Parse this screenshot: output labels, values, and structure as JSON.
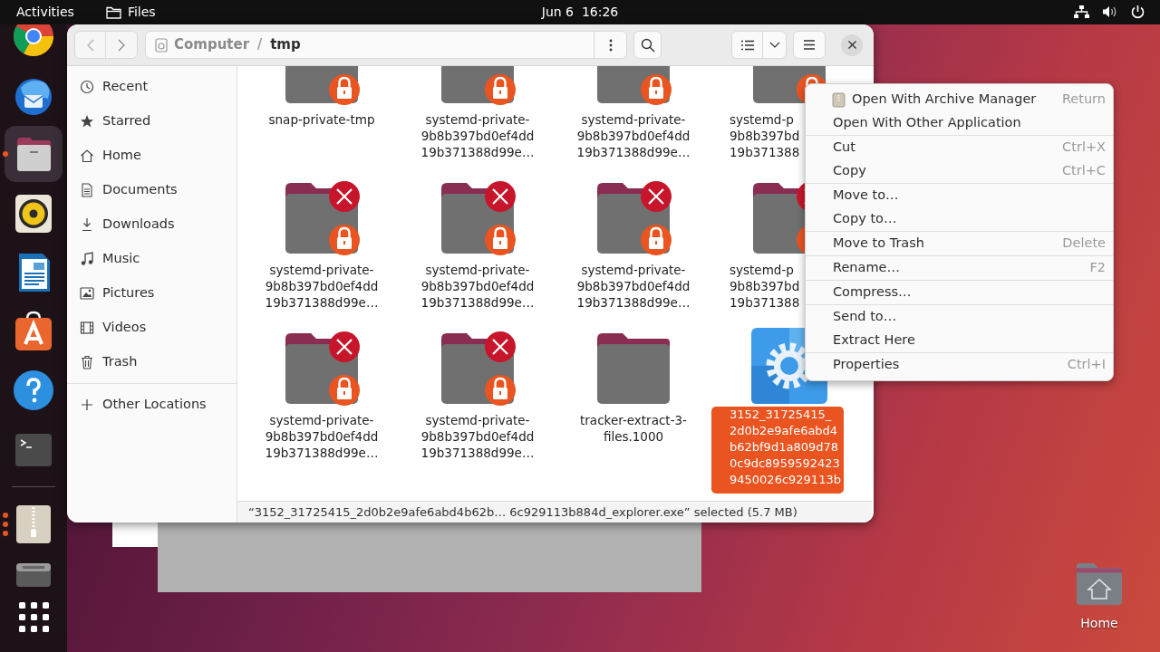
{
  "top_bar": {
    "activities": "Activities",
    "app_name": "Files",
    "clock": "Jun 6  16:26"
  },
  "dock": {
    "favorites": [
      {
        "active": false,
        "running": false
      },
      {
        "active": false,
        "running": false
      },
      {
        "active": true,
        "running": true,
        "multiple_windows": false
      },
      {
        "active": false,
        "running": false
      },
      {
        "active": false,
        "running": false
      },
      {
        "active": false,
        "running": false
      },
      {
        "active": false,
        "running": false
      },
      {
        "active": false,
        "running": false
      }
    ],
    "running": [
      {
        "active": false,
        "running": true,
        "multiple_windows": true
      },
      {
        "active": false,
        "running": false
      }
    ]
  },
  "files_window": {
    "path": [
      {
        "label": "Computer",
        "selected": false
      },
      {
        "label": "tmp",
        "selected": true
      }
    ],
    "path_separator": "/",
    "sidebar": {
      "places": [
        {
          "label": "Recent",
          "selected": false
        },
        {
          "label": "Starred",
          "selected": false
        },
        {
          "label": "Home",
          "selected": false
        },
        {
          "label": "Documents",
          "selected": false
        },
        {
          "label": "Downloads",
          "selected": false
        },
        {
          "label": "Music",
          "selected": false
        },
        {
          "label": "Pictures",
          "selected": false
        },
        {
          "label": "Videos",
          "selected": false
        },
        {
          "label": "Trash",
          "selected": false
        }
      ],
      "other": {
        "label": "Other Locations",
        "selected": false
      }
    },
    "items": [
      {
        "kind": "folder",
        "locked": true,
        "unreadable": false,
        "selected": false,
        "label_lines": [
          "snap-private-tmp"
        ]
      },
      {
        "kind": "folder",
        "locked": true,
        "unreadable": false,
        "selected": false,
        "label_lines": [
          "systemd-private-",
          "9b8b397bd0ef4dd",
          "19b371388d99e…"
        ]
      },
      {
        "kind": "folder",
        "locked": true,
        "unreadable": false,
        "selected": false,
        "label_lines": [
          "systemd-private-",
          "9b8b397bd0ef4dd",
          "19b371388d99e…"
        ]
      },
      {
        "kind": "folder",
        "locked": true,
        "unreadable": false,
        "selected": false,
        "label_lines": [
          "systemd-p",
          "9b8b397bd",
          "19b371388"
        ]
      },
      {
        "kind": "folder",
        "locked": true,
        "unreadable": true,
        "selected": false,
        "label_lines": [
          "systemd-private-",
          "9b8b397bd0ef4dd",
          "19b371388d99e…"
        ]
      },
      {
        "kind": "folder",
        "locked": true,
        "unreadable": true,
        "selected": false,
        "label_lines": [
          "systemd-private-",
          "9b8b397bd0ef4dd",
          "19b371388d99e…"
        ]
      },
      {
        "kind": "folder",
        "locked": true,
        "unreadable": true,
        "selected": false,
        "label_lines": [
          "systemd-private-",
          "9b8b397bd0ef4dd",
          "19b371388d99e…"
        ]
      },
      {
        "kind": "folder",
        "locked": true,
        "unreadable": true,
        "selected": false,
        "label_lines": [
          "systemd-p",
          "9b8b397bd",
          "19b371388"
        ]
      },
      {
        "kind": "folder",
        "locked": true,
        "unreadable": true,
        "selected": false,
        "label_lines": [
          "systemd-private-",
          "9b8b397bd0ef4dd",
          "19b371388d99e…"
        ]
      },
      {
        "kind": "folder",
        "locked": true,
        "unreadable": true,
        "selected": false,
        "label_lines": [
          "systemd-private-",
          "9b8b397bd0ef4dd",
          "19b371388d99e…"
        ]
      },
      {
        "kind": "folder",
        "locked": false,
        "unreadable": false,
        "selected": false,
        "label_lines": [
          "tracker-extract-3-",
          "files.1000"
        ]
      },
      {
        "kind": "executable",
        "selected": true,
        "label_lines": [
          "3152_31725415_",
          "2d0b2e9afe6abd4",
          "b62bf9d1a809d78",
          "0c9dc8959592423",
          "9450026c929113b"
        ]
      }
    ],
    "status": "“3152_31725415_2d0b2e9afe6abd4b62b…  6c929113b884d_explorer.exe” selected (5.7 MB)"
  },
  "context_menu": {
    "groups": [
      [
        {
          "kind": "app",
          "label": "Open With Archive Manager",
          "shortcut": "Return"
        },
        {
          "kind": "plain",
          "label": "Open With Other Application"
        }
      ],
      [
        {
          "kind": "plain",
          "label": "Cut",
          "shortcut": "Ctrl+X"
        },
        {
          "kind": "plain",
          "label": "Copy",
          "shortcut": "Ctrl+C"
        }
      ],
      [
        {
          "kind": "plain",
          "label": "Move to…"
        },
        {
          "kind": "plain",
          "label": "Copy to…"
        }
      ],
      [
        {
          "kind": "plain",
          "label": "Move to Trash",
          "shortcut": "Delete"
        }
      ],
      [
        {
          "kind": "plain",
          "label": "Rename…",
          "shortcut": "F2"
        }
      ],
      [
        {
          "kind": "plain",
          "label": "Compress…"
        }
      ],
      [
        {
          "kind": "plain",
          "label": "Send to…"
        },
        {
          "kind": "plain",
          "label": "Extract Here"
        }
      ],
      [
        {
          "kind": "plain",
          "label": "Properties",
          "shortcut": "Ctrl+I"
        }
      ]
    ]
  },
  "desktop": {
    "icons": [
      {
        "label": "Home"
      }
    ]
  }
}
